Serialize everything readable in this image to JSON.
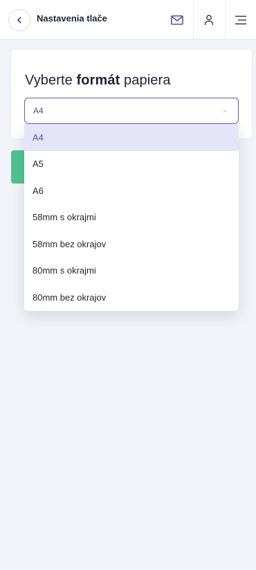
{
  "header": {
    "title": "Nastavenia tlače",
    "icons": [
      "chevron-left-icon",
      "mail-icon",
      "user-icon",
      "menu-icon"
    ],
    "accent_color": "#4a4fc4"
  },
  "card": {
    "title_prefix": "Vyberte ",
    "title_bold": "formát",
    "title_suffix": " papiera"
  },
  "select": {
    "value": "A4",
    "expanded": true
  },
  "dropdown": {
    "options": [
      {
        "label": "A4",
        "selected": true
      },
      {
        "label": "A5",
        "selected": false
      },
      {
        "label": "A6",
        "selected": false
      },
      {
        "label": "58mm s okrajmi",
        "selected": false
      },
      {
        "label": "58mm bez okrajov",
        "selected": false
      },
      {
        "label": "80mm s okrajmi",
        "selected": false
      },
      {
        "label": "80mm bez okrajov",
        "selected": false
      }
    ]
  },
  "colors": {
    "background": "#f2f3f8",
    "selected_option_bg": "#e4e5f7",
    "green_button": "#4fc38d"
  }
}
